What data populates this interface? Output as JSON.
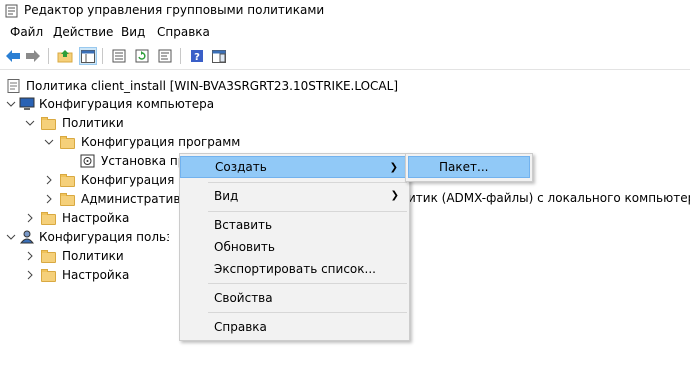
{
  "window": {
    "title": "Редактор управления групповыми политиками",
    "icon": "gpo-editor-icon"
  },
  "menubar": {
    "file": "Файл",
    "action": "Действие",
    "view": "Вид",
    "help": "Справка"
  },
  "toolbar": {
    "buttons": [
      "back-icon",
      "forward-icon",
      "up-folder-icon",
      "show-hide-tree-icon",
      "export-list-icon",
      "refresh-icon",
      "properties-icon",
      "help-icon",
      "show-pane-icon"
    ]
  },
  "tree": {
    "root": "Политика client_install [WIN-BVA3SRGRT23.10STRIKE.LOCAL]",
    "computer_config": "Конфигурация компьютера",
    "cc_policies": "Политики",
    "software_config": "Конфигурация программ",
    "software_install": "Установка программ",
    "windows_config": "Конфигурация Windows",
    "admin_templates": "Административные шаблоны: определения политик (ADMX-файлы) с локального компьютера.",
    "admin_templates_visible": "Административные",
    "admin_templates_tail": "итик (ADMX-файлы) с локального компьютера.",
    "cc_settings": "Настройка",
    "user_config": "Конфигурация пользователя",
    "uc_policies": "Политики",
    "uc_settings": "Настройка"
  },
  "context_menu": {
    "create": "Создать",
    "view": "Вид",
    "paste": "Вставить",
    "refresh": "Обновить",
    "export": "Экспортировать список...",
    "properties": "Свойства",
    "help": "Справка"
  },
  "submenu": {
    "package": "Пакет..."
  },
  "colors": {
    "highlight": "#91c9f7",
    "menu_bg": "#f2f2f2",
    "folder": "#f5d07a"
  }
}
